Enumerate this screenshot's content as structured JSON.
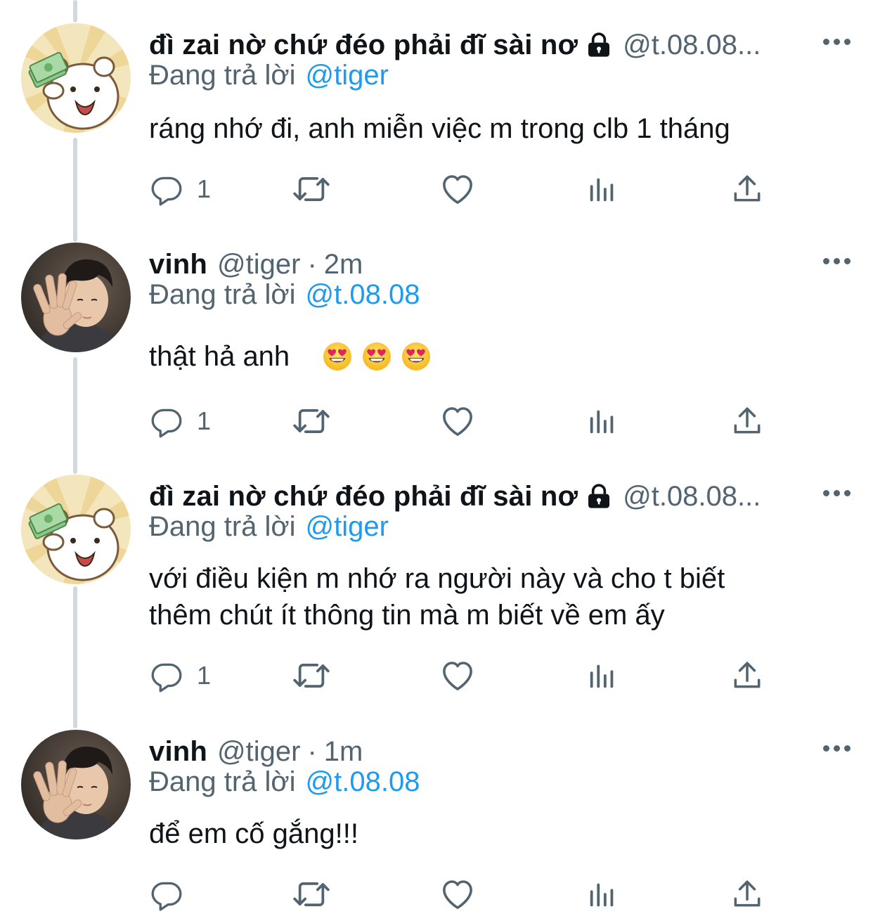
{
  "colors": {
    "accent": "#1d9bf0",
    "secondary_text": "#536471",
    "thread_line": "#cfd9de"
  },
  "tweets": [
    {
      "name": "đì zai nờ chứ đéo phải đĩ sài nơ",
      "locked": true,
      "handle": "@t.08.08...",
      "time": "",
      "replying_label": "Đang trả lời",
      "replying_to": "@tiger",
      "text": "ráng nhớ đi, anh miễn việc m trong clb 1 tháng",
      "reply_count": "1",
      "avatar": "cartoon-bear-avatar"
    },
    {
      "name": "vinh",
      "locked": false,
      "handle": "@tiger",
      "time": "2m",
      "replying_label": "Đang trả lời",
      "replying_to": "@t.08.08",
      "text": "thật hả anh",
      "emojis": [
        "heart-eyes-emoji",
        "heart-eyes-emoji",
        "heart-eyes-emoji"
      ],
      "reply_count": "1",
      "avatar": "photo-avatar"
    },
    {
      "name": "đì zai nờ chứ đéo phải đĩ sài nơ",
      "locked": true,
      "handle": "@t.08.08...",
      "time": "",
      "replying_label": "Đang trả lời",
      "replying_to": "@tiger",
      "text_lines": [
        "với điều kiện m nhớ ra người này và cho t biết",
        "thêm chút ít thông tin mà m biết về em ấy"
      ],
      "reply_count": "1",
      "avatar": "cartoon-bear-avatar"
    },
    {
      "name": "vinh",
      "locked": false,
      "handle": "@tiger",
      "time": "1m",
      "replying_label": "Đang trả lời",
      "replying_to": "@t.08.08",
      "text": "để em cố gắng!!!",
      "reply_count": "",
      "avatar": "photo-avatar"
    }
  ]
}
